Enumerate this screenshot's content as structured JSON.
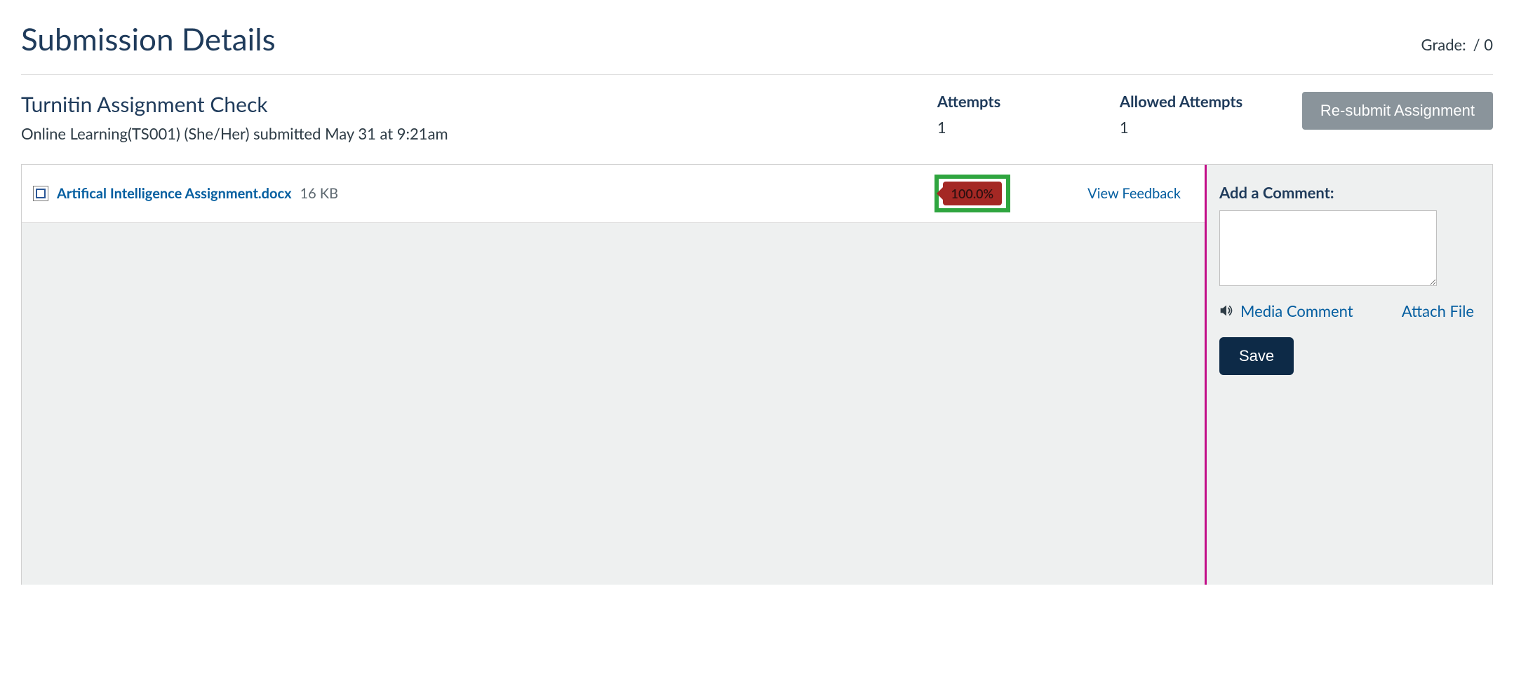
{
  "header": {
    "title": "Submission Details",
    "grade_label": "Grade:",
    "grade_denominator": "/ 0"
  },
  "assignment": {
    "title": "Turnitin Assignment Check",
    "submitted_line": "Online Learning(TS001) (She/Her) submitted May 31 at 9:21am",
    "attempts_label": "Attempts",
    "attempts_value": "1",
    "allowed_label": "Allowed Attempts",
    "allowed_value": "1",
    "resubmit_label": "Re-submit Assignment"
  },
  "file": {
    "name": "Artifical Intelligence Assignment.docx",
    "size": "16 KB",
    "plagiarism_percent": "100.0%",
    "feedback_label": "View Feedback"
  },
  "comments": {
    "heading": "Add a Comment:",
    "media_label": "Media Comment",
    "attach_label": "Attach File",
    "save_label": "Save"
  }
}
